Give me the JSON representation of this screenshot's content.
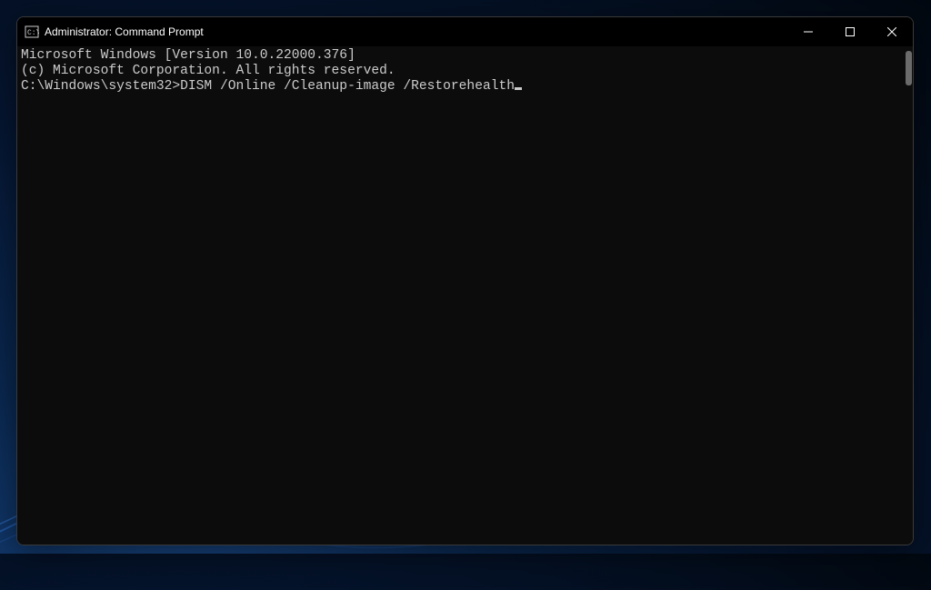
{
  "window": {
    "title": "Administrator: Command Prompt"
  },
  "console": {
    "line1": "Microsoft Windows [Version 10.0.22000.376]",
    "line2": "(c) Microsoft Corporation. All rights reserved.",
    "blank": "",
    "prompt": "C:\\Windows\\system32>",
    "command": "DISM /Online /Cleanup-image /Restorehealth"
  }
}
